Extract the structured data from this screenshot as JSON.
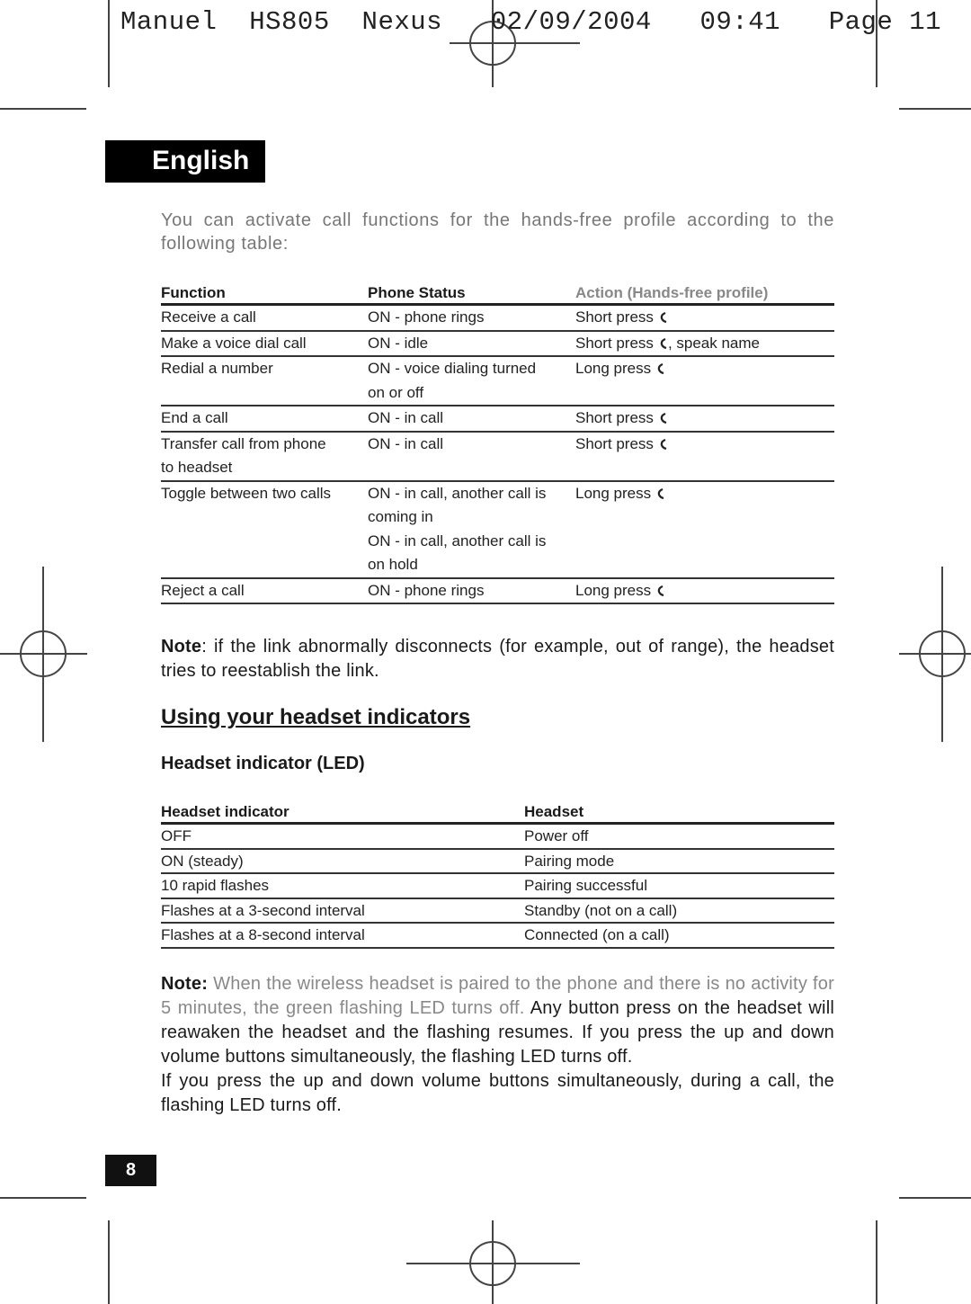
{
  "slug_line": "Manuel  HS805  Nexus   02/09/2004   09:41   Page 11",
  "language_tab": "English",
  "intro": "You can activate call functions for the hands-free profile according to the following table:",
  "call_table": {
    "headers": [
      "Function",
      "Phone Status",
      "Action (Hands-free profile)"
    ],
    "rows": [
      {
        "function": "Receive a call",
        "status": "ON - phone rings",
        "action": "Short press",
        "action_suffix": ""
      },
      {
        "function": "Make a voice dial call",
        "status": "ON -  idle",
        "action": "Short press",
        "action_suffix": ", speak name"
      },
      {
        "function": "Redial a number",
        "status": "ON - voice dialing turned on or off",
        "action": "Long press",
        "action_suffix": ""
      },
      {
        "function": "End a call",
        "status": "ON - in call",
        "action": "Short press",
        "action_suffix": ""
      },
      {
        "function": "Transfer call from phone to headset",
        "status": "ON - in call",
        "action": "Short press",
        "action_suffix": ""
      },
      {
        "function": "Toggle between two calls",
        "status": "ON - in call, another call is coming in",
        "status_2": "ON - in call, another call is on hold",
        "action": "Long press",
        "action_suffix": ""
      },
      {
        "function": "Reject a call",
        "status": "ON - phone rings",
        "action": "Long press",
        "action_suffix": ""
      }
    ],
    "icon": "phone-handset-icon"
  },
  "note1": {
    "label": "Note",
    "text": ": if the link abnormally disconnects (for example, out of range), the headset tries to reestablish the link."
  },
  "section_title": "Using your headset indicators",
  "subsection_title": "Headset indicator (LED)",
  "led_table": {
    "headers": [
      "Headset indicator",
      "Headset"
    ],
    "rows": [
      [
        "OFF",
        "Power off"
      ],
      [
        "ON (steady)",
        "Pairing mode"
      ],
      [
        "10 rapid flashes",
        "Pairing successful"
      ],
      [
        "Flashes at a 3-second interval",
        "Standby (not on a call)"
      ],
      [
        "Flashes at a 8-second interval",
        "Connected (on a call)"
      ]
    ]
  },
  "note2": {
    "label": "Note:",
    "muted_text": " When the wireless headset is paired to the phone and there is no activity for 5 minutes, the green flashing LED turns off.",
    "text": " Any button press on the headset will reawaken the headset and the flashing resumes. If you press the up and down volume buttons simultaneously, the flashing LED turns off.",
    "text2": "If you press the up and down volume buttons simultaneously, during a call, the flashing LED turns off."
  },
  "page_number": "8"
}
